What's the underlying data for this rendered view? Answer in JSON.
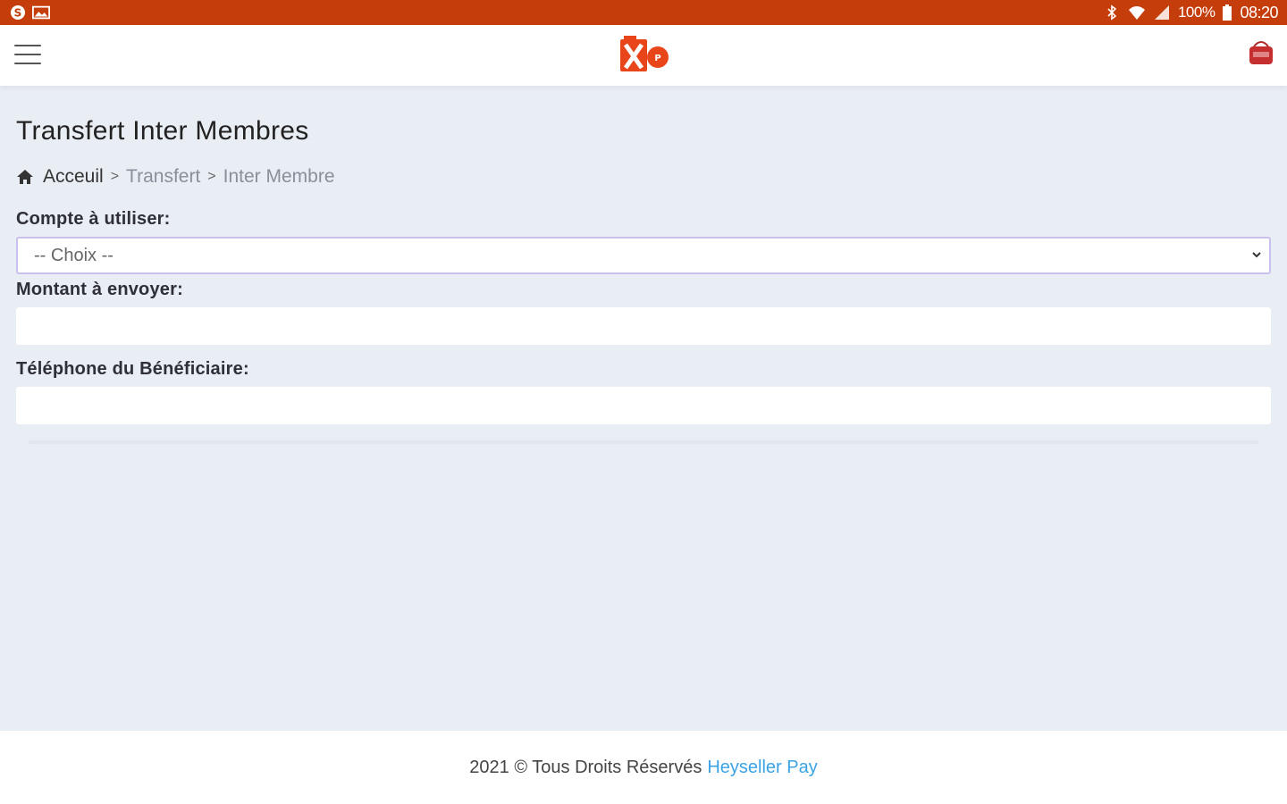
{
  "statusbar": {
    "battery": "100%",
    "time": "08:20",
    "icons": [
      "skype-icon",
      "gallery-icon",
      "bluetooth-icon",
      "wifi-icon",
      "signal-icon",
      "battery-icon"
    ]
  },
  "header": {
    "logo_icon": "heyseller-logo",
    "menu_icon": "hamburger-menu-icon",
    "cart_icon": "shopping-bag-icon",
    "accent": "#c53d0a"
  },
  "page": {
    "title": "Transfert Inter Membres"
  },
  "breadcrumb": {
    "home": "Acceuil",
    "sep": ">",
    "items": [
      "Transfert",
      "Inter Membre"
    ]
  },
  "form": {
    "account_label": "Compte à utiliser:",
    "account_selected": "-- Choix --",
    "amount_label": "Montant à envoyer:",
    "amount_value": "",
    "phone_label": "Téléphone du Bénéficiaire:",
    "phone_value": ""
  },
  "footer": {
    "text": "2021 © Tous Droits Réservés",
    "brand": "Heyseller Pay",
    "brand_color": "#3aa3e6"
  }
}
